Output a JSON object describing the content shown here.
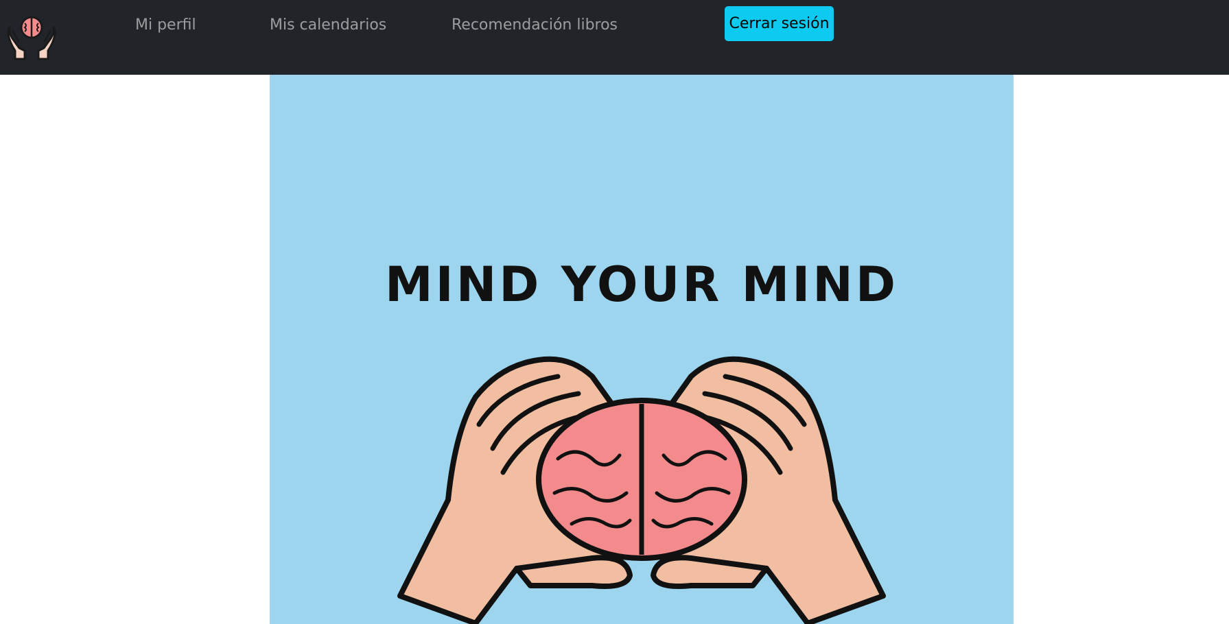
{
  "navbar": {
    "logo_icon": "brain-in-hands-icon",
    "links": [
      {
        "label": "Mi perfil"
      },
      {
        "label": "Mis calendarios"
      },
      {
        "label": "Recomendación libros"
      }
    ],
    "logout_label": "Cerrar sesión"
  },
  "hero": {
    "headline": "MIND YOUR MIND",
    "illustration": "hands-holding-brain-icon"
  },
  "colors": {
    "navbar_bg": "#212529",
    "link_color": "rgba(255,255,255,0.55)",
    "logout_bg": "#0dcaf0",
    "hero_bg": "#9dd5ee",
    "skin": "#f1bea1",
    "brain": "#f38a8c"
  }
}
